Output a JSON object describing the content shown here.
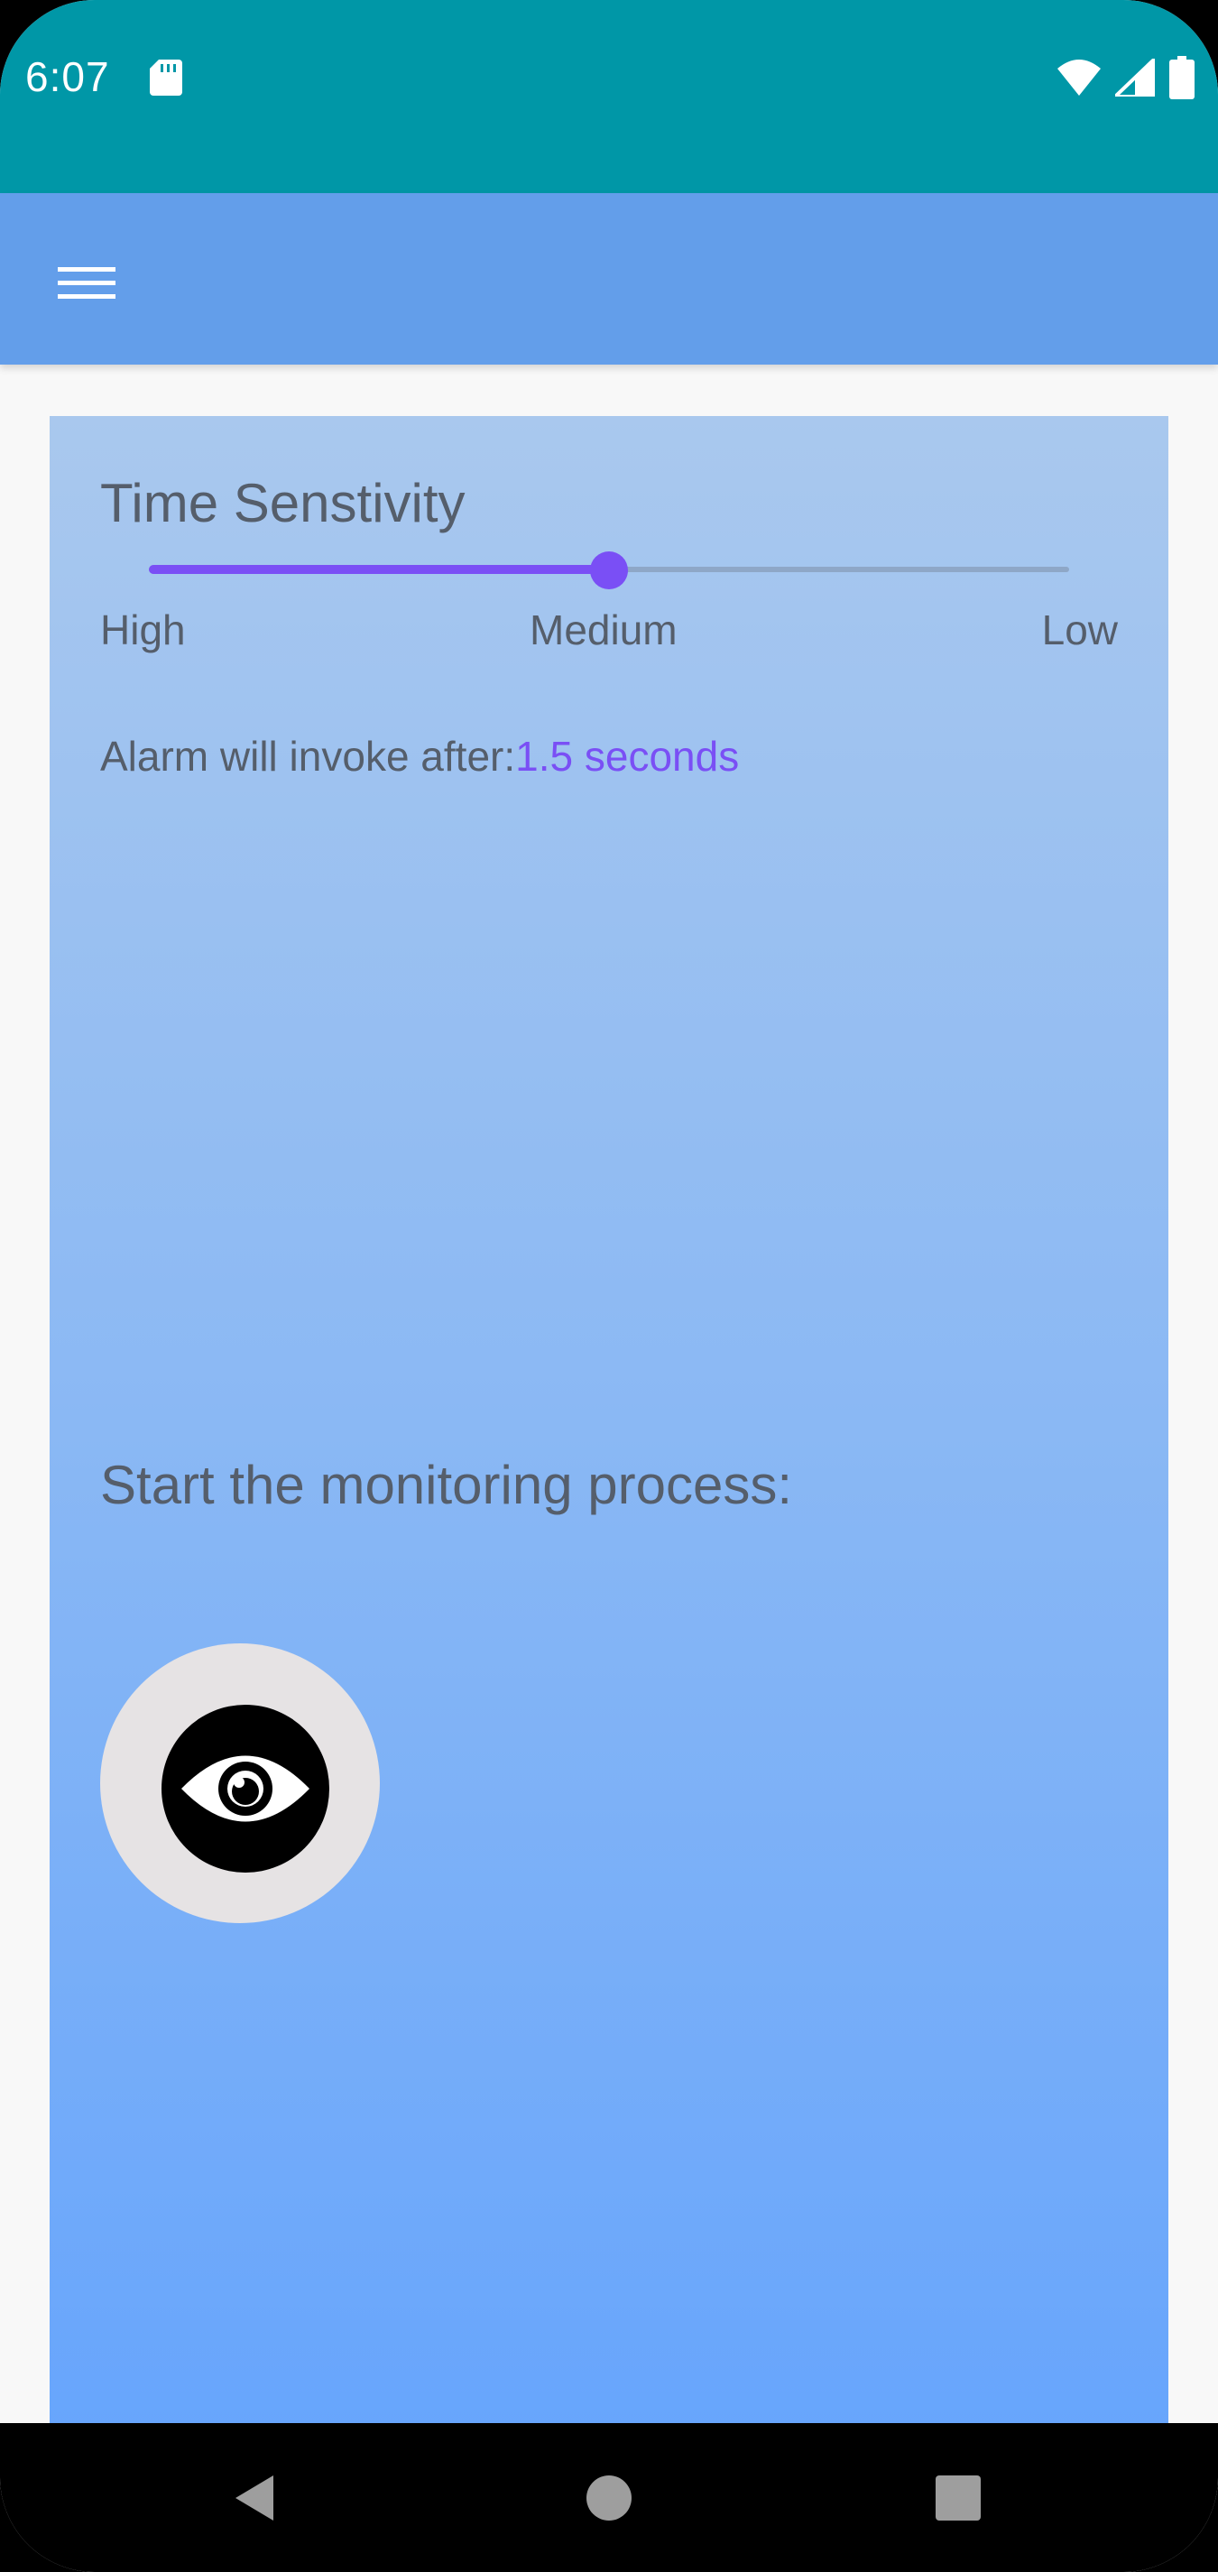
{
  "status_bar": {
    "time": "6:07",
    "icons": [
      "sd-card-icon",
      "wifi-icon",
      "signal-icon",
      "battery-icon"
    ],
    "background_color": "#0097a7"
  },
  "app_bar": {
    "menu_icon": "hamburger-menu-icon",
    "background_color": "#639eea"
  },
  "settings": {
    "title": "Time Senstivity",
    "slider": {
      "value": 0.5,
      "labels": [
        "High",
        "Medium",
        "Low"
      ],
      "accent_color": "#7a4ff5"
    },
    "alarm_label": "Alarm will invoke after:",
    "alarm_value": "1.5 seconds"
  },
  "monitor": {
    "label": "Start the monitoring process:",
    "button_icon": "eye-icon"
  },
  "nav_bar": {
    "buttons": [
      "back-icon",
      "home-icon",
      "recents-icon"
    ]
  }
}
